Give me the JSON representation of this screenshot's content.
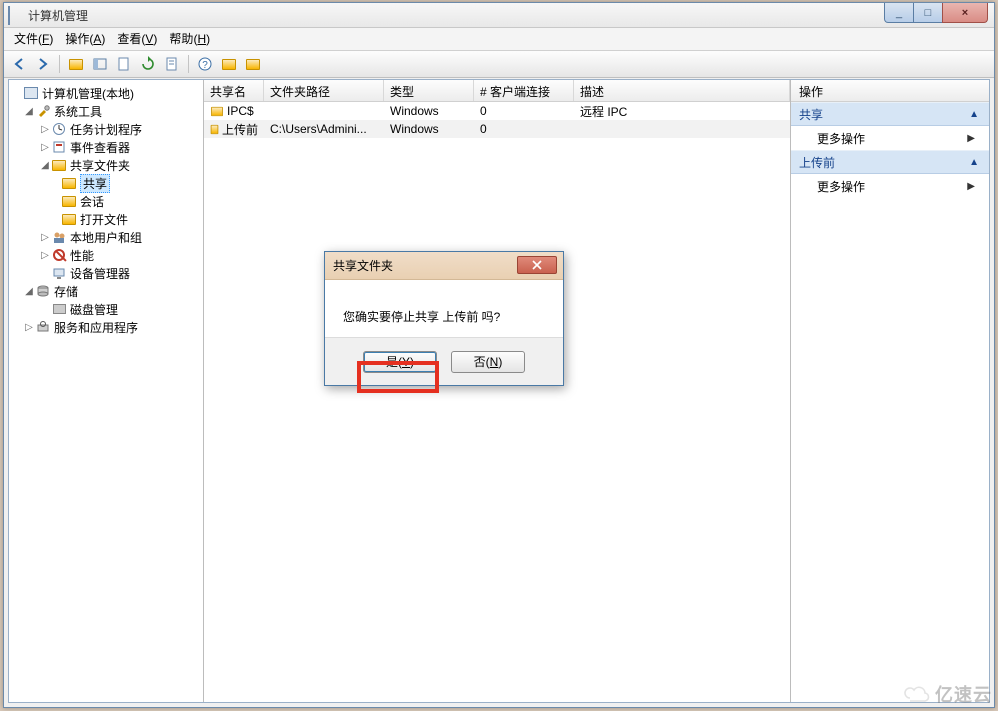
{
  "window": {
    "title": "计算机管理",
    "minimize": "_",
    "maximize": "□",
    "close": "×"
  },
  "menubar": {
    "file": {
      "label": "文件",
      "hotkey": "F"
    },
    "action": {
      "label": "操作",
      "hotkey": "A"
    },
    "view": {
      "label": "查看",
      "hotkey": "V"
    },
    "help": {
      "label": "帮助",
      "hotkey": "H"
    }
  },
  "tree": {
    "root": "计算机管理(本地)",
    "system_tools": "系统工具",
    "task_scheduler": "任务计划程序",
    "event_viewer": "事件查看器",
    "shared_folders": "共享文件夹",
    "shares": "共享",
    "sessions": "会话",
    "open_files": "打开文件",
    "local_users": "本地用户和组",
    "performance": "性能",
    "device_manager": "设备管理器",
    "storage": "存储",
    "disk_mgmt": "磁盘管理",
    "services_apps": "服务和应用程序"
  },
  "list": {
    "headers": {
      "share_name": "共享名",
      "folder_path": "文件夹路径",
      "type": "类型",
      "clients": "# 客户端连接",
      "desc": "描述"
    },
    "rows": [
      {
        "name": "IPC$",
        "path": "",
        "type": "Windows",
        "clients": "0",
        "desc": "远程 IPC"
      },
      {
        "name": "上传前",
        "path": "C:\\Users\\Admini...",
        "type": "Windows",
        "clients": "0",
        "desc": ""
      }
    ]
  },
  "actions": {
    "header": "操作",
    "section1": "共享",
    "opt1": "更多操作",
    "section2": "上传前",
    "opt2": "更多操作"
  },
  "dialog": {
    "title": "共享文件夹",
    "message": "您确实要停止共享 上传前 吗?",
    "yes_label": "是",
    "yes_hotkey": "Y",
    "no_label": "否",
    "no_hotkey": "N"
  },
  "watermark": "亿速云"
}
